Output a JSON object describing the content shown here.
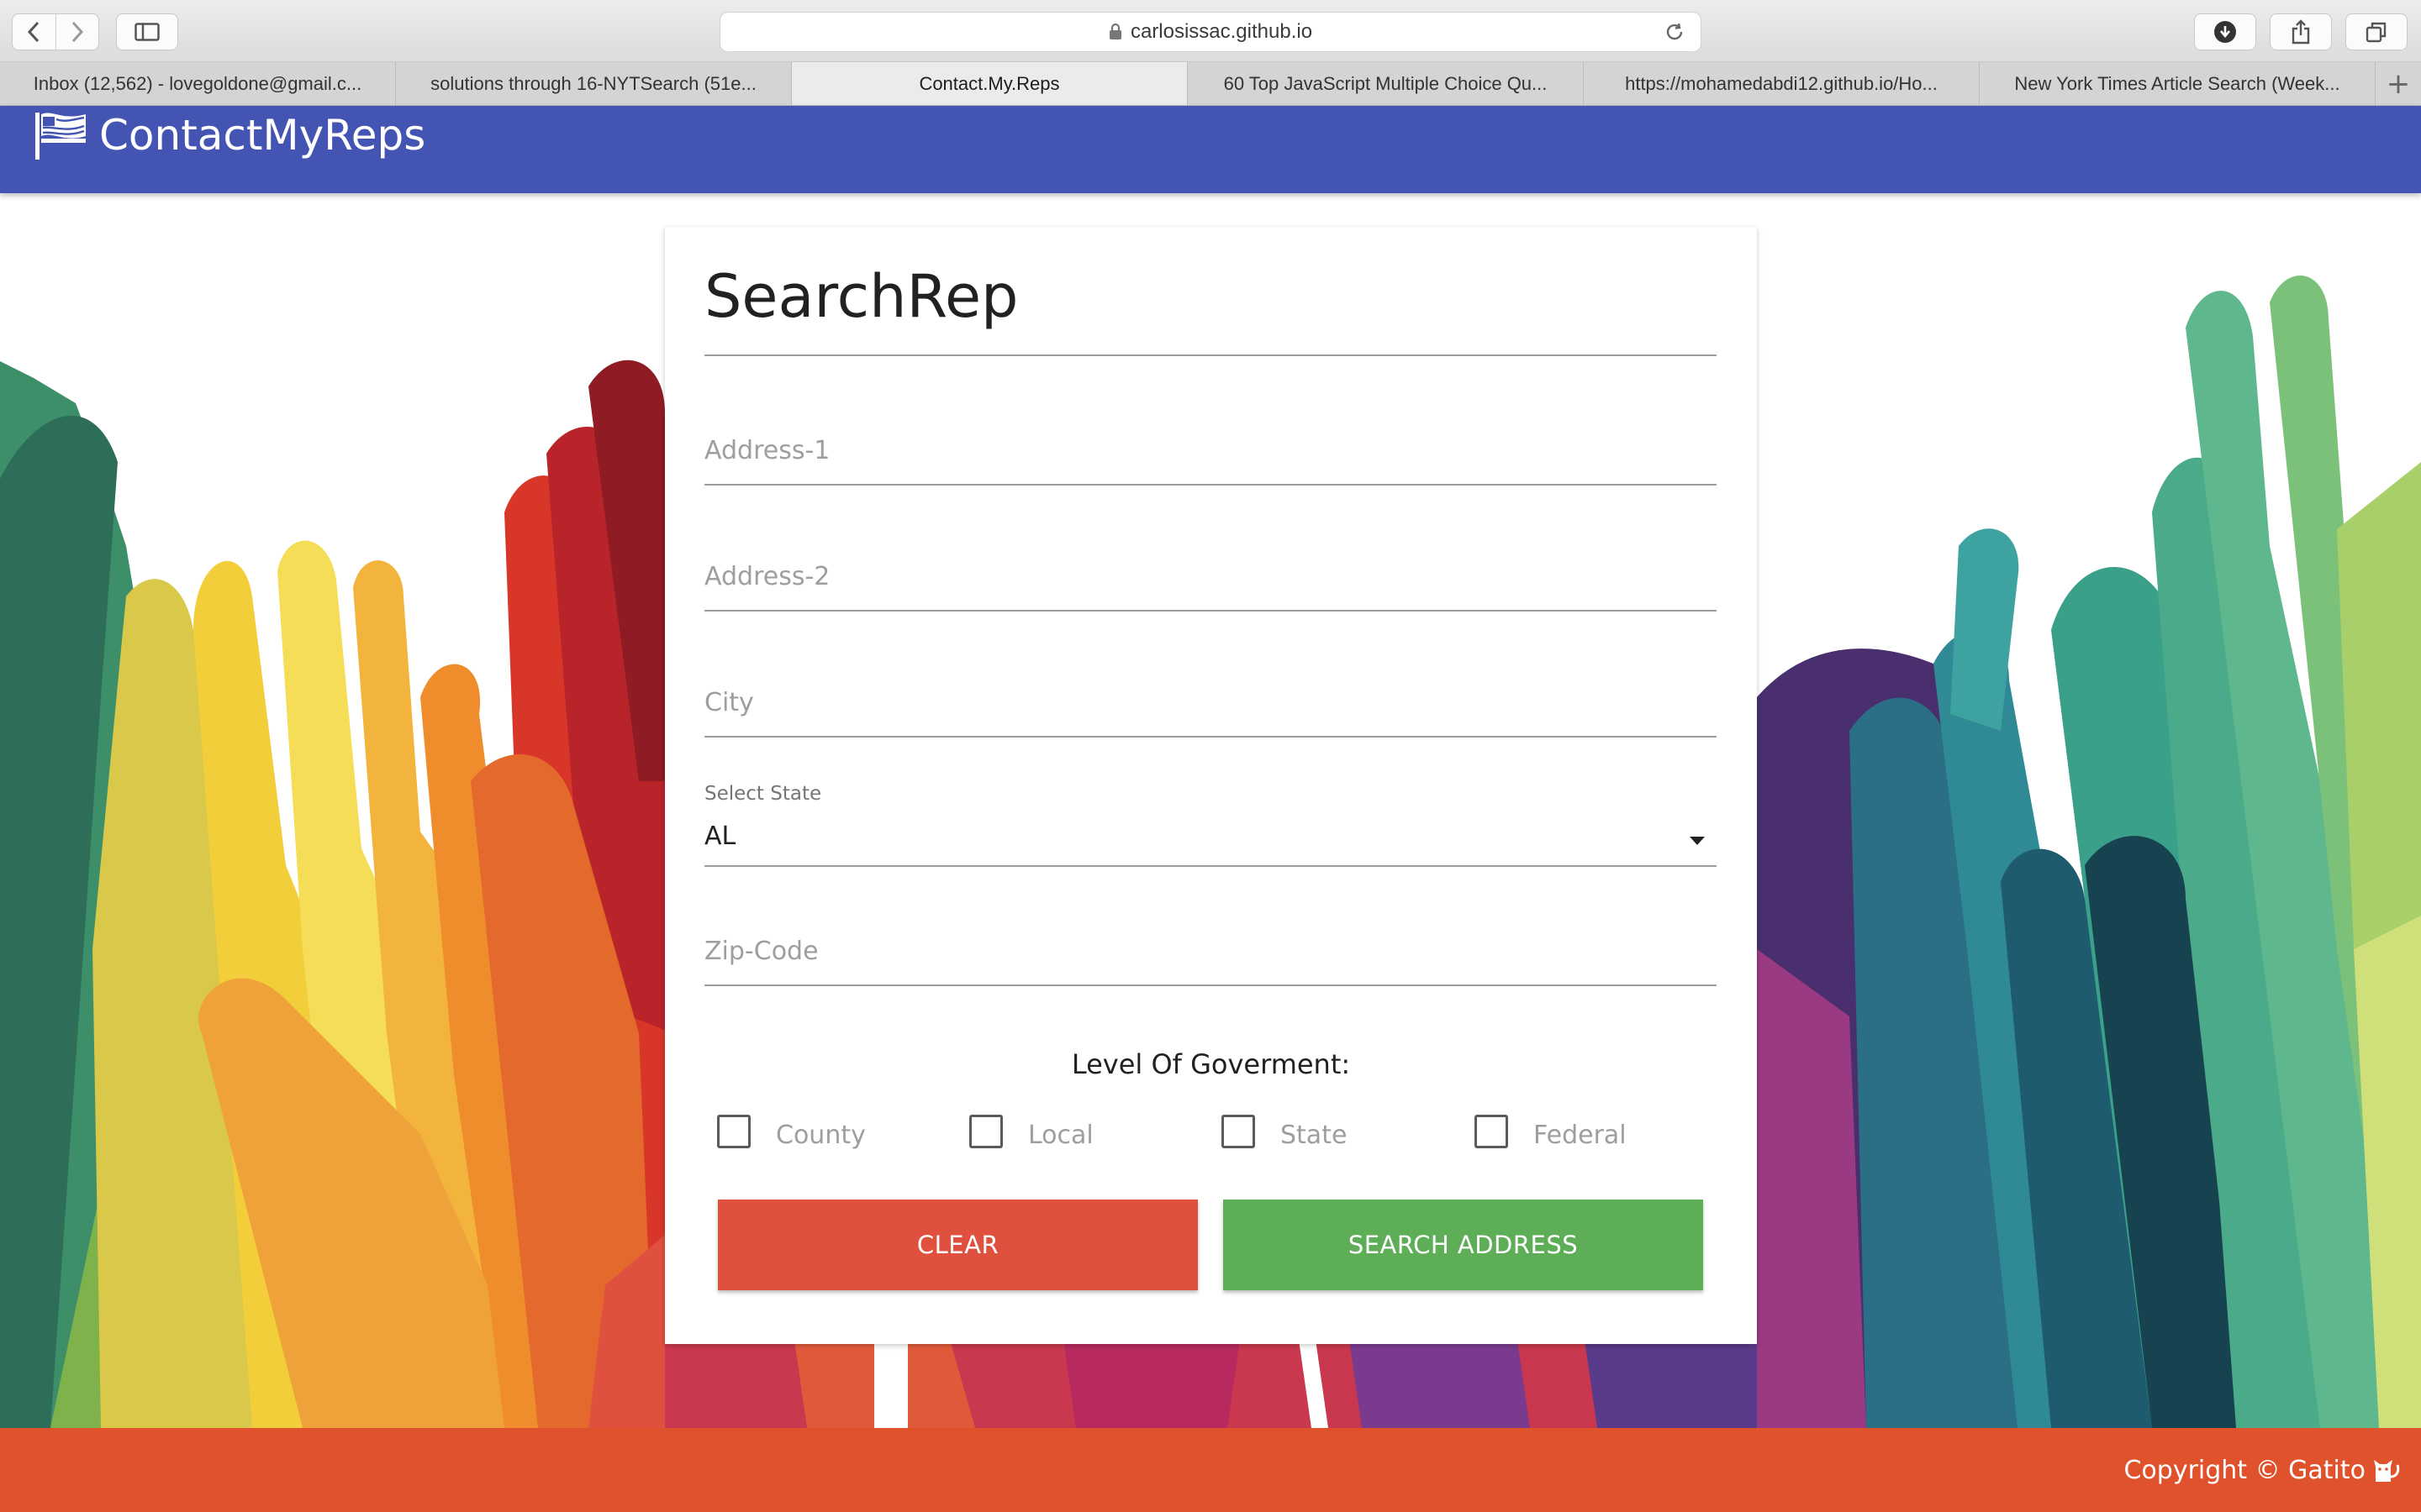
{
  "browser": {
    "url": "carlosissac.github.io",
    "tabs": [
      {
        "label": "Inbox (12,562) - lovegoldone@gmail.c..."
      },
      {
        "label": "solutions through 16-NYTSearch (51e..."
      },
      {
        "label": "Contact.My.Reps"
      },
      {
        "label": "60 Top JavaScript Multiple Choice Qu..."
      },
      {
        "label": "https://mohamedabdi12.github.io/Ho..."
      },
      {
        "label": "New York Times Article Search (Week..."
      }
    ],
    "active_tab_index": 2,
    "new_tab_symbol": "+"
  },
  "navbar": {
    "brand": "ContactMyReps",
    "color": "#4354b3"
  },
  "form": {
    "title": "SearchRep",
    "address1": {
      "placeholder": "Address-1",
      "value": ""
    },
    "address2": {
      "placeholder": "Address-2",
      "value": ""
    },
    "city": {
      "placeholder": "City",
      "value": ""
    },
    "state": {
      "label": "Select State",
      "value": "AL"
    },
    "zip": {
      "placeholder": "Zip-Code",
      "value": ""
    },
    "level_label": "Level Of Goverment:",
    "levels": [
      {
        "label": "County",
        "checked": false
      },
      {
        "label": "Local",
        "checked": false
      },
      {
        "label": "State",
        "checked": false
      },
      {
        "label": "Federal",
        "checked": false
      }
    ],
    "clear_label": "CLEAR",
    "search_label": "SEARCH ADDRESS",
    "clear_color": "#e0503f",
    "search_color": "#5eae58"
  },
  "footer": {
    "text": "Copyright © Gatito",
    "color": "#e0522c"
  }
}
